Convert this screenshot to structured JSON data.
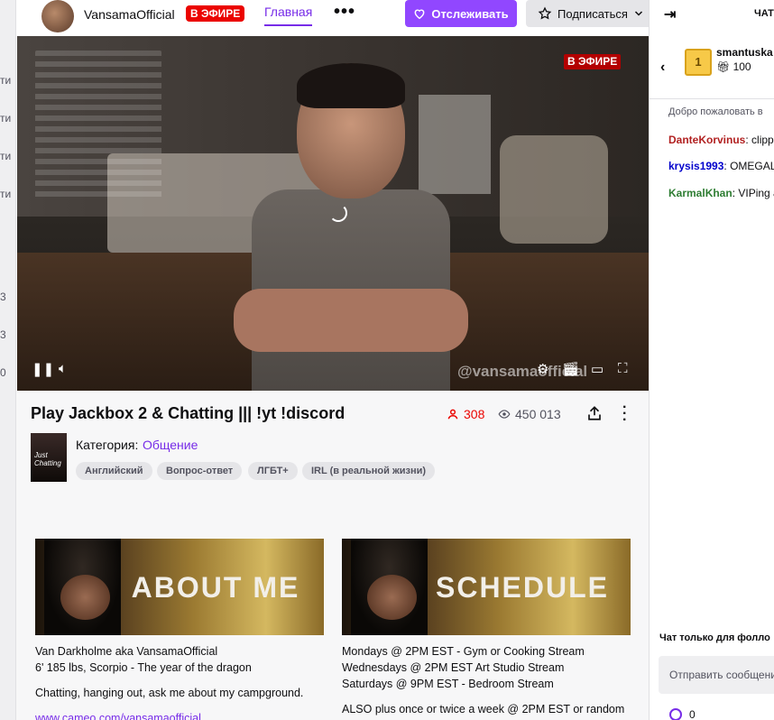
{
  "channel": {
    "name": "VansamaOfficial",
    "live_badge": "В ЭФИРЕ",
    "tab_home": "Главная",
    "more": "•••",
    "follow_label": "Отслеживать",
    "subscribe_label": "Подписаться"
  },
  "video": {
    "live_badge": "В ЭФИРЕ",
    "watermark": "@vansamaofficial"
  },
  "stream": {
    "title": "Play Jackbox 2 & Chatting ||| !yt !discord",
    "viewers": "308",
    "views": "450 013",
    "category_label": "Категория:",
    "category": "Общение",
    "box_art_text": "Just Chatting",
    "tags": [
      "Английский",
      "Вопрос-ответ",
      "ЛГБТ+",
      "IRL (в реальной жизни)"
    ]
  },
  "panels": {
    "about": {
      "banner": "ABOUT ME",
      "line1": "Van Darkholme aka VansamaOfficial",
      "line2": "6' 185 lbs, Scorpio - The year of the dragon",
      "line3": "Chatting, hanging out, ask me about my campground.",
      "link": "www.cameo.com/vansamaofficial"
    },
    "schedule": {
      "banner": "SCHEDULE",
      "line1": "Mondays @ 2PM EST - Gym or Cooking Stream",
      "line2": "Wednesdays @ 2PM EST Art Studio Stream",
      "line3": "Saturdays @ 9PM EST - Bedroom Stream",
      "line4": "ALSO plus once or twice a week @ 2PM EST or random"
    }
  },
  "chat": {
    "title": "ЧАТ",
    "gift_user": "smantuska",
    "gift_badge": "1",
    "gift_count": "100",
    "welcome": "Добро пожаловать в",
    "messages": [
      {
        "user": "DanteKorvinus",
        "text": ": clippe",
        "color": "#b22222"
      },
      {
        "user": "krysis1993",
        "text": ": OMEGALU",
        "color": "#0000cc"
      },
      {
        "user": "KarmalKhan",
        "text": ": VIPing a",
        "color": "#2e7d32"
      }
    ],
    "followers_only": "Чат только для фолло",
    "input_placeholder": "Отправить сообщени",
    "points": "0"
  },
  "rail": {
    "items": [
      "ти",
      "ти",
      "ти",
      "ти",
      "3",
      "3",
      "0"
    ]
  }
}
